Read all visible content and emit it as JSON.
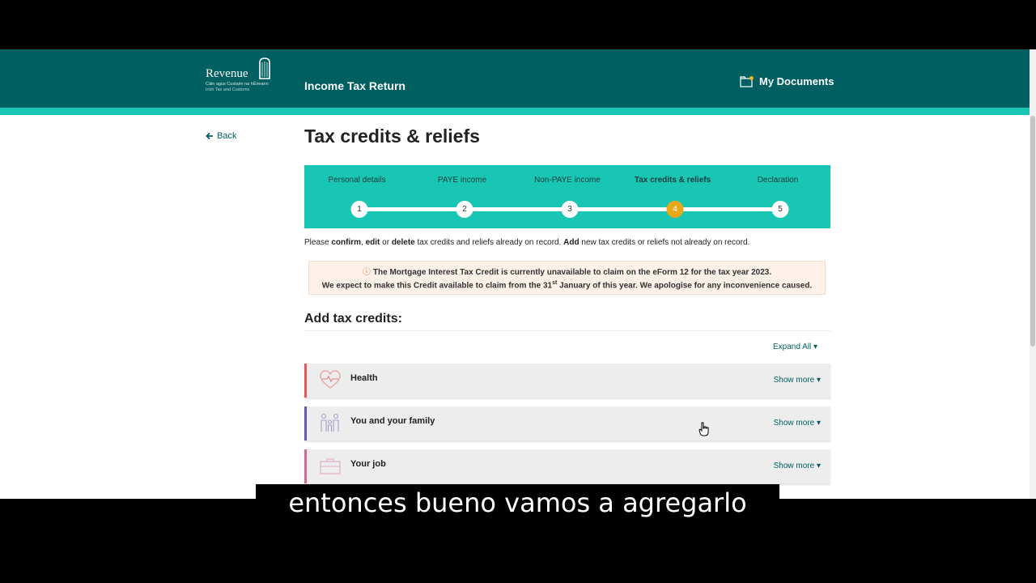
{
  "header": {
    "logo": {
      "word": "Revenue",
      "sub1": "Cáin agus Custaim na hÉireann",
      "sub2": "Irish Tax and Customs"
    },
    "app_title": "Income Tax Return",
    "my_documents": "My Documents",
    "colors": {
      "header": "#005f61",
      "stripe": "#19c5b3"
    }
  },
  "nav": {
    "back": "Back",
    "back_icon": "arrow-left-icon"
  },
  "page": {
    "title": "Tax credits & reliefs"
  },
  "stepper": {
    "steps": [
      {
        "number": "1",
        "label": "Personal details",
        "active": false
      },
      {
        "number": "2",
        "label": "PAYE income",
        "active": false
      },
      {
        "number": "3",
        "label": "Non-PAYE income",
        "active": false
      },
      {
        "number": "4",
        "label": "Tax credits & reliefs",
        "active": true
      },
      {
        "number": "5",
        "label": "Declaration",
        "active": false
      }
    ],
    "active_color": "#e9a818"
  },
  "instructions": {
    "p1": "Please ",
    "confirm": "confirm",
    "p2": ", ",
    "edit": "edit",
    "p3": " or ",
    "delete": "delete",
    "p4": " tax credits and reliefs already on record. ",
    "add": "Add",
    "p5": " new tax credits or reliefs not already on record."
  },
  "alert": {
    "icon": "ⓘ",
    "line1": "The Mortgage Interest Tax Credit is currently unavailable to claim on the eForm 12 for the tax year 2023.",
    "line2_a": "We expect to make this Credit available to claim from the 31",
    "line2_sup": "st",
    "line2_b": " January of this year. We apologise for any inconvenience caused."
  },
  "section": {
    "title": "Add tax credits:",
    "expand_all": "Expand All"
  },
  "accordions": [
    {
      "title": "Health",
      "show_more": "Show more",
      "icon": "heart-icon",
      "color": "#e05a5a"
    },
    {
      "title": "You and your family",
      "show_more": "Show more",
      "icon": "family-icon",
      "color": "#6a5aa8"
    },
    {
      "title": "Your job",
      "show_more": "Show more",
      "icon": "briefcase-icon",
      "color": "#d06a9a"
    }
  ],
  "subtitle": "entonces bueno vamos a agregarlo"
}
